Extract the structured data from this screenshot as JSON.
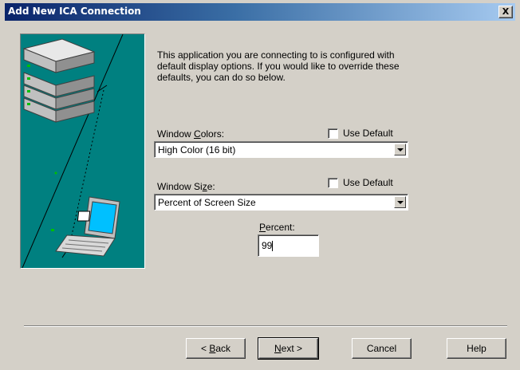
{
  "window": {
    "title": "Add New ICA Connection",
    "close_label": "X"
  },
  "intro_text": "This application you are connecting to is configured with\ndefault display options.  If you would like to override these\ndefaults, you can do so below.",
  "window_colors": {
    "label_pre": "Window ",
    "label_accel": "C",
    "label_post": "olors:",
    "use_default_label": "Use Default",
    "use_default_checked": false,
    "selected": "High Color (16 bit)"
  },
  "window_size": {
    "label_pre": "Window Si",
    "label_accel": "z",
    "label_post": "e:",
    "use_default_label": "Use Default",
    "use_default_checked": false,
    "selected": "Percent of Screen Size"
  },
  "percent": {
    "label_accel": "P",
    "label_post": "ercent:",
    "value": "99"
  },
  "buttons": {
    "back_pre": "< ",
    "back_accel": "B",
    "back_post": "ack",
    "next_accel": "N",
    "next_post": "ext >",
    "cancel": "Cancel",
    "help": "Help"
  },
  "colors": {
    "panel_teal": "#008080",
    "title_blue": "#0a246a",
    "dialog_gray": "#d4d0c8"
  }
}
